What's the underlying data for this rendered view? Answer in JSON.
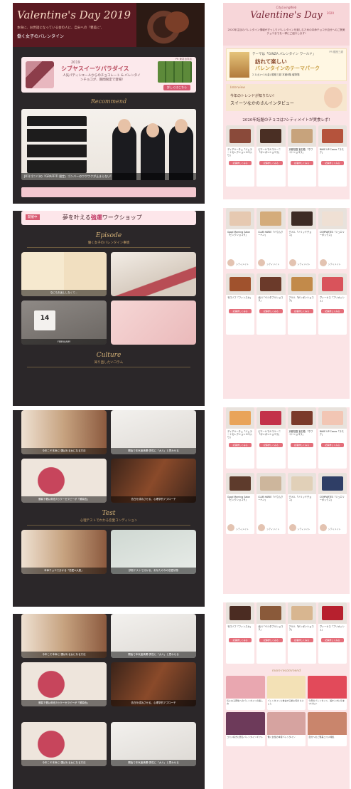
{
  "left": {
    "header": {
      "title": "Valentine's Day 2019",
      "line1": "本命に、お世話になっている会の人に、自分への『褒美に',",
      "line2": "働く女子のバレンタイン"
    },
    "ad": {
      "year": "2019",
      "title": "シブヤスイーツパラダイス",
      "desc": "人気パティシエールからのチョコレート & バレンタインチョコが、期間限定で登場!",
      "cta": "詳しくはこちら",
      "logo": "PR 東急百貨店"
    },
    "recommend_label": "Recommend",
    "hero_caption": "JO1(ゴニバ)の『GRAFFITI 限定』ゴンバーのワクワクが止まらない!",
    "workshop": {
      "tag": "開催中",
      "title_pre": "夢を叶える",
      "title_hl": "強運",
      "title_post": "ワークショップ"
    },
    "episode": {
      "name": "Episode",
      "jp": "働く女子のバレンタイン事情"
    },
    "episode_cards": [
      "なにもお返ししなくて…"
    ],
    "calendar_text": "14",
    "calendar_month": "FEBRUARY",
    "culture": {
      "name": "Culture",
      "jp": "知り直したいコラム"
    },
    "test": {
      "name": "Test",
      "jp": "心理テストでわかる恋愛コンディション"
    },
    "culture_captions": [
      "今年こそ本命に!選ばれる女になる方法",
      "開始で本気度満開!男性に「大人」と思わせる",
      "勝負下着は何色?カラーセラピーが「勝負色」",
      "告白を成功させる、心理学的アプローチ"
    ],
    "test_captions": [
      "本命チョコで分かる「恋愛★大胆」",
      "診断テストで分かる、あなたの今の恋愛状態"
    ]
  },
  "right": {
    "brand": "CityLivingWeb",
    "title": "Valentine's Day",
    "year": "2020",
    "desc": "2020年注目のバレンタイン情報がぎっしり!バレンタインを楽しむための本命チョコや自分へのご褒美チョコまでを一挙にご紹介します!",
    "banner": {
      "pre": "テーマは「GINZA バレンタイン ワールド」",
      "title": "訪れて楽しい",
      "subtitle": "バレンタインのテーマパーク",
      "dates": "2.1(土)〜14(金)  銀座三越 本館8階 催物場",
      "logo": "PR 銀座三越"
    },
    "interview": {
      "label": "Interview",
      "line1": "今年のトレンドが知りたい!",
      "line2": "スイーツなかのさんインタビュー"
    },
    "section_title": "2020年話題のチョコは?シティメイトが実食レポ!",
    "products": [
      {
        "name": "ディアルーチェ「ジェラートセレクション 6コ入り」",
        "button": "記事詳しくみる",
        "reviewer": "ライター OL"
      },
      {
        "name": "ピエールマルコリーニ「ボンボンショコラ」",
        "button": "記事詳しくみる",
        "reviewer": "シティメイト"
      },
      {
        "name": "京都祇園 宝石箱 「ホワイトショコラ」",
        "button": "記事詳しくみる",
        "reviewer": "シティメイト"
      },
      {
        "name": "BAKE UP Cacao「ラスク」",
        "button": "記事詳しくみる",
        "reviewer": "シティメイト"
      },
      {
        "name": "Good Morning Salon「ピンクショコラ」",
        "button": "記事詳しくみる",
        "reviewer": "シティメイト"
      },
      {
        "name": "CLUB HARIE「バウムクーヘン」",
        "button": "記事詳しくみる",
        "reviewer": "シティメイト"
      },
      {
        "name": "デメル「ソリッドチョコ」",
        "button": "記事詳しくみる",
        "reviewer": "シティメイト"
      },
      {
        "name": "COMPARTES「ジュエリーボックス」",
        "button": "記事詳しくみる",
        "reviewer": "シティメイト"
      },
      {
        "name": "モロゾフ「フィンスカ」",
        "button": "記事詳しくみる",
        "reviewer": "シティメイト"
      },
      {
        "name": "北川「ベジタブルショコラ」",
        "button": "記事詳しくみる",
        "reviewer": "シティメイト"
      },
      {
        "name": "アルル「ボンボンショコラ」",
        "button": "記事詳しくみる",
        "reviewer": "シティメイト"
      },
      {
        "name": "ヴィーナス「ブリオッシュ」",
        "button": "記事詳しくみる",
        "reviewer": "シティメイト"
      }
    ],
    "recommend_label": "more recommend",
    "recommend_items": [
      "気になる男性へのバレンタインの渡し方",
      "バレンタインに告白する前に知りたいこと",
      "今年のバレンタイン、渡すときに気をつけたい",
      "コスメ好きに贈るバレンタインギフト",
      "働く女性の本音バレンタイン",
      "自分へのご褒美コスメ特集"
    ]
  }
}
